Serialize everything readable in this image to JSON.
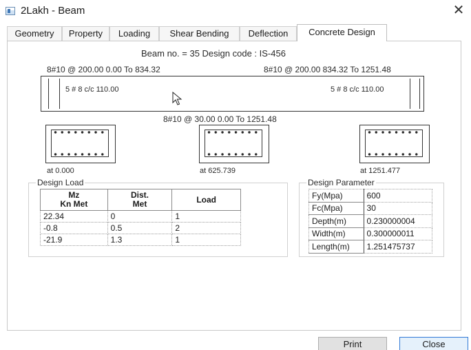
{
  "window": {
    "title": "2Lakh - Beam",
    "close_glyph": "✕"
  },
  "tabs": [
    {
      "label": "Geometry",
      "active": false
    },
    {
      "label": "Property",
      "active": false
    },
    {
      "label": "Loading",
      "active": false
    },
    {
      "label": "Shear Bending",
      "active": false
    },
    {
      "label": "Deflection",
      "active": false
    },
    {
      "label": "Concrete Design",
      "active": true
    }
  ],
  "design": {
    "header": "Beam no. = 35  Design code :  IS-456",
    "top_left_rebar": "8#10 @ 200.00 0.00 To 834.32",
    "top_right_rebar": "8#10 @ 200.00 834.32 To 1251.48",
    "left_stirrup": "5 # 8 c/c 110.00",
    "right_stirrup": "5 # 8 c/c 110.00",
    "bottom_rebar": "8#10 @ 30.00 0.00 To 1251.48",
    "sections": [
      "at 0.000",
      "at 625.739",
      "at 1251.477"
    ]
  },
  "design_load": {
    "title": "Design Load",
    "headers": [
      "Mz\nKn Met",
      "Dist.\nMet",
      "Load"
    ],
    "rows": [
      [
        "22.34",
        "0",
        "1"
      ],
      [
        "-0.8",
        "0.5",
        "2"
      ],
      [
        "-21.9",
        "1.3",
        "1"
      ]
    ]
  },
  "design_parameter": {
    "title": "Design Parameter",
    "rows": [
      [
        "Fy(Mpa)",
        "600"
      ],
      [
        "Fc(Mpa)",
        "30"
      ],
      [
        "Depth(m)",
        "0.230000004"
      ],
      [
        "Width(m)",
        "0.300000011"
      ],
      [
        "Length(m)",
        "1.251475737"
      ]
    ]
  },
  "buttons": {
    "print": "Print",
    "close": "Close"
  },
  "colors": {
    "accent": "#2f78d6",
    "button_face": "#e1e1e1"
  }
}
